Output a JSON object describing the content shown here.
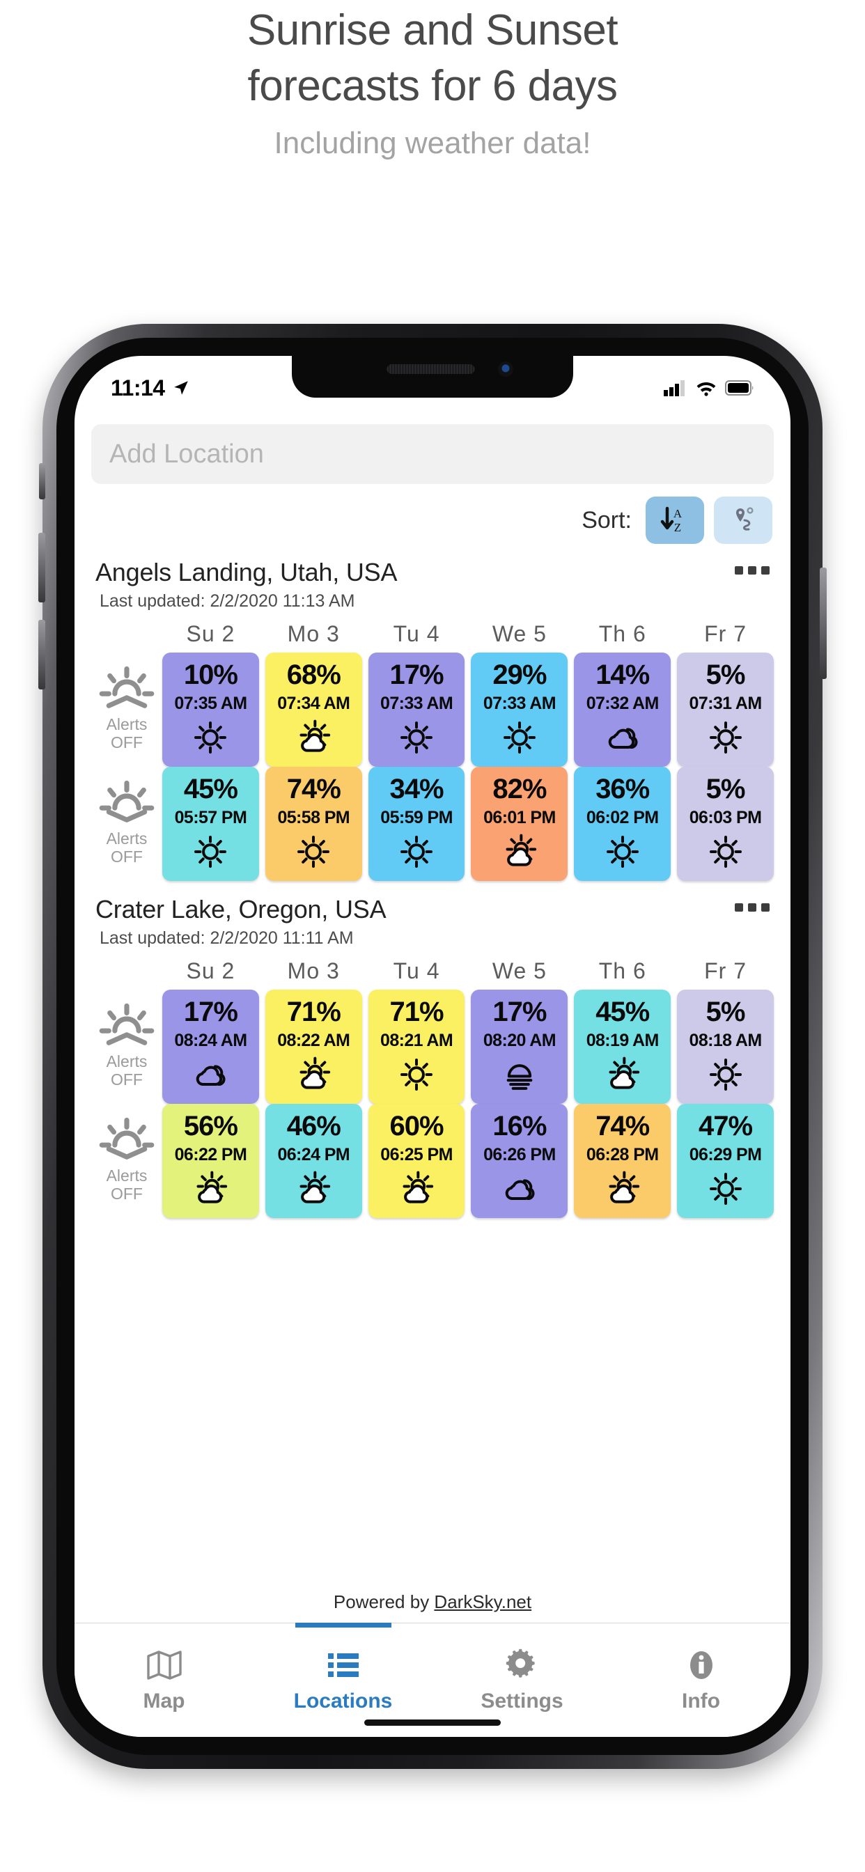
{
  "promo": {
    "title_line1": "Sunrise and Sunset",
    "title_line2": "forecasts for 6 days",
    "subtitle": "Including weather data!"
  },
  "status_bar": {
    "time": "11:14",
    "location_arrow_icon": "location-arrow-icon",
    "cellular_icon": "cellular-bars-icon",
    "wifi_icon": "wifi-icon",
    "battery_icon": "battery-full-icon"
  },
  "search": {
    "value": "",
    "placeholder": "Add Location"
  },
  "sort": {
    "label": "Sort:",
    "alpha_button_icon": "sort-alpha-down-icon",
    "distance_button_icon": "route-pin-icon",
    "active": "alpha"
  },
  "day_headers": [
    "Su 2",
    "Mo 3",
    "Tu 4",
    "We 5",
    "Th 6",
    "Fr 7"
  ],
  "alerts_label_line1": "Alerts",
  "alerts_label_line2": "OFF",
  "menu_icon": "ellipsis-icon",
  "locations": [
    {
      "name": "Angels Landing, Utah, USA",
      "last_updated": "Last updated: 2/2/2020 11:13 AM",
      "sunrise": {
        "icon": "sunrise-icon",
        "alerts": "OFF",
        "cells": [
          {
            "pct": "10%",
            "time": "07:35 AM",
            "wx": "sun",
            "color": "#9a95e6"
          },
          {
            "pct": "68%",
            "time": "07:34 AM",
            "wx": "sun-cloud",
            "color": "#fbf062"
          },
          {
            "pct": "17%",
            "time": "07:33 AM",
            "wx": "sun",
            "color": "#9a95e6"
          },
          {
            "pct": "29%",
            "time": "07:33 AM",
            "wx": "sun",
            "color": "#62cbf5"
          },
          {
            "pct": "14%",
            "time": "07:32 AM",
            "wx": "cloud",
            "color": "#9a95e6"
          },
          {
            "pct": "5%",
            "time": "07:31 AM",
            "wx": "sun",
            "color": "#cdc9e8"
          }
        ]
      },
      "sunset": {
        "icon": "sunset-icon",
        "alerts": "OFF",
        "cells": [
          {
            "pct": "45%",
            "time": "05:57 PM",
            "wx": "sun",
            "color": "#75e0e4"
          },
          {
            "pct": "74%",
            "time": "05:58 PM",
            "wx": "sun",
            "color": "#fbcb6a"
          },
          {
            "pct": "34%",
            "time": "05:59 PM",
            "wx": "sun",
            "color": "#62cbf5"
          },
          {
            "pct": "82%",
            "time": "06:01 PM",
            "wx": "sun-cloud",
            "color": "#fba272"
          },
          {
            "pct": "36%",
            "time": "06:02 PM",
            "wx": "sun",
            "color": "#62cbf5"
          },
          {
            "pct": "5%",
            "time": "06:03 PM",
            "wx": "sun",
            "color": "#cdc9e8"
          }
        ]
      }
    },
    {
      "name": "Crater Lake, Oregon, USA",
      "last_updated": "Last updated: 2/2/2020 11:11 AM",
      "sunrise": {
        "icon": "sunrise-icon",
        "alerts": "OFF",
        "cells": [
          {
            "pct": "17%",
            "time": "08:24 AM",
            "wx": "cloud",
            "color": "#9a95e6"
          },
          {
            "pct": "71%",
            "time": "08:22 AM",
            "wx": "sun-cloud",
            "color": "#fbf062"
          },
          {
            "pct": "71%",
            "time": "08:21 AM",
            "wx": "sun",
            "color": "#fbf062"
          },
          {
            "pct": "17%",
            "time": "08:20 AM",
            "wx": "fog",
            "color": "#9a95e6"
          },
          {
            "pct": "45%",
            "time": "08:19 AM",
            "wx": "sun-cloud",
            "color": "#75e0e4"
          },
          {
            "pct": "5%",
            "time": "08:18 AM",
            "wx": "sun",
            "color": "#cdc9e8"
          }
        ]
      },
      "sunset": {
        "icon": "sunset-icon",
        "alerts": "OFF",
        "cells": [
          {
            "pct": "56%",
            "time": "06:22 PM",
            "wx": "sun-cloud",
            "color": "#e2f27a"
          },
          {
            "pct": "46%",
            "time": "06:24 PM",
            "wx": "sun-cloud",
            "color": "#75e0e4"
          },
          {
            "pct": "60%",
            "time": "06:25 PM",
            "wx": "sun-cloud",
            "color": "#fbf062"
          },
          {
            "pct": "16%",
            "time": "06:26 PM",
            "wx": "cloud",
            "color": "#9a95e6"
          },
          {
            "pct": "74%",
            "time": "06:28 PM",
            "wx": "sun-cloud",
            "color": "#fbcb6a"
          },
          {
            "pct": "47%",
            "time": "06:29 PM",
            "wx": "sun",
            "color": "#75e0e4"
          }
        ]
      }
    }
  ],
  "footer": {
    "powered_prefix": "Powered by ",
    "powered_link": "DarkSky.net"
  },
  "tabs": [
    {
      "label": "Map",
      "icon": "map-icon",
      "active": false
    },
    {
      "label": "Locations",
      "icon": "list-icon",
      "active": true
    },
    {
      "label": "Settings",
      "icon": "gear-icon",
      "active": false
    },
    {
      "label": "Info",
      "icon": "info-icon",
      "active": false
    }
  ],
  "colors": {
    "accent": "#2b7bc0",
    "sort_active": "#8ec0e4",
    "sort_idle": "#cfe4f4"
  }
}
